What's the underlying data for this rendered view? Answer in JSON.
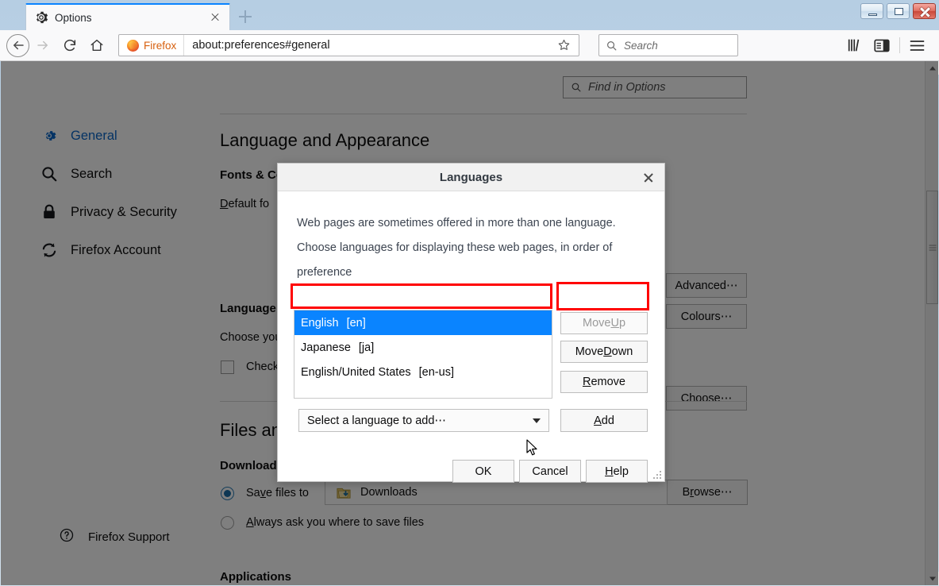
{
  "window": {
    "controls": {
      "minimize": "minimize",
      "maximize": "maximize",
      "close": "close"
    }
  },
  "tabbar": {
    "tab_title": "Options",
    "tab_icon": "gear-icon",
    "close_icon": "close-icon",
    "new_tab_icon": "plus-icon"
  },
  "toolbar": {
    "back_icon": "back-arrow-icon",
    "forward_icon": "forward-arrow-icon",
    "reload_icon": "reload-icon",
    "home_icon": "home-icon",
    "identity_label": "Firefox",
    "url": "about:preferences#general",
    "bookmark_icon": "star-icon",
    "search_placeholder": "Search",
    "search_icon": "search-icon",
    "library_icon": "library-icon",
    "sidebar_icon": "sidebar-icon",
    "menu_icon": "hamburger-menu-icon"
  },
  "sidebar": {
    "items": [
      {
        "label": "General",
        "icon": "gear-icon",
        "active": true
      },
      {
        "label": "Search",
        "icon": "search-icon",
        "active": false
      },
      {
        "label": "Privacy & Security",
        "icon": "lock-icon",
        "active": false
      },
      {
        "label": "Firefox Account",
        "icon": "sync-icon",
        "active": false
      }
    ],
    "support": {
      "label": "Firefox Support",
      "icon": "question-circle-icon"
    }
  },
  "main": {
    "find_placeholder": "Find in Options",
    "find_icon": "search-icon",
    "section_language_appearance": "Language and Appearance",
    "subsection_fonts_colours": "Fonts & Colours",
    "default_font_label": "Default font",
    "btn_advanced": "Advanced⋯",
    "btn_colours": "Colours⋯",
    "subsection_language": "Language",
    "language_desc": "Choose your",
    "checkbox_label": "Check",
    "btn_choose": "Choose⋯",
    "section_files_applications": "Files and",
    "subsection_downloads": "Downloads",
    "radio_save_files_to": "Save files to",
    "downloads_folder": "Downloads",
    "folder_icon": "downloads-folder-icon",
    "btn_browse": "Browse⋯",
    "radio_always_ask": "Always ask you where to save files",
    "section_applications": "Applications"
  },
  "dialog": {
    "title": "Languages",
    "close_icon": "close-icon",
    "description": "Web pages are sometimes offered in more than one language. Choose languages for displaying these web pages, in order of preference",
    "languages": [
      {
        "name": "English",
        "code": "[en]",
        "selected": true
      },
      {
        "name": "Japanese",
        "code": "[ja]",
        "selected": false
      },
      {
        "name": "English/United States",
        "code": "[en-us]",
        "selected": false
      }
    ],
    "buttons": {
      "move_up": "Move Up",
      "move_down": "Move Down",
      "remove": "Remove",
      "add": "Add"
    },
    "move_up_disabled": true,
    "select_add_value": "Select a language to add⋯",
    "footer": {
      "ok": "OK",
      "cancel": "Cancel",
      "help": "Help"
    }
  },
  "annotations": {
    "highlight_color": "#ff0000",
    "boxes": [
      "selected-language-row",
      "move-up-button"
    ]
  },
  "scrollbar": {
    "up_icon": "scroll-up-icon",
    "down_icon": "scroll-down-icon"
  }
}
